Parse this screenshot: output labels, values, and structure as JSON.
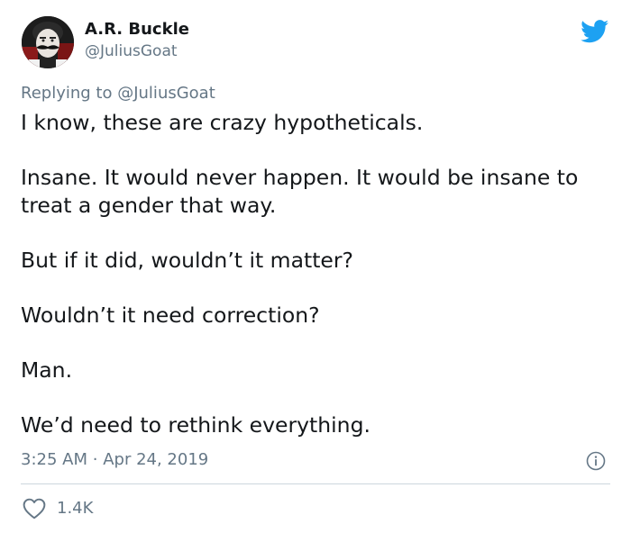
{
  "author": {
    "name": "A.R. Buckle",
    "handle": "@JuliusGoat"
  },
  "reply": {
    "prefix": "Replying to",
    "mention": "@JuliusGoat"
  },
  "tweet": {
    "paragraphs": [
      "I know, these are crazy hypotheticals.",
      "Insane. It would never happen. It would be insane to treat a gender that way.",
      "But if it did, wouldn’t it matter?",
      "Wouldn’t it need correction?",
      "Man.",
      "We’d need to rethink everything."
    ],
    "time": "3:25 AM",
    "separator": "·",
    "date": "Apr 24, 2019"
  },
  "engagement": {
    "likes": "1.4K"
  },
  "icons": {
    "brand": "twitter-bird-icon",
    "info": "info-icon",
    "like": "heart-icon"
  },
  "colors": {
    "brand_blue": "#1da1f2",
    "muted_text": "#657786",
    "text": "#14171a",
    "divider": "#ccd6dd"
  }
}
